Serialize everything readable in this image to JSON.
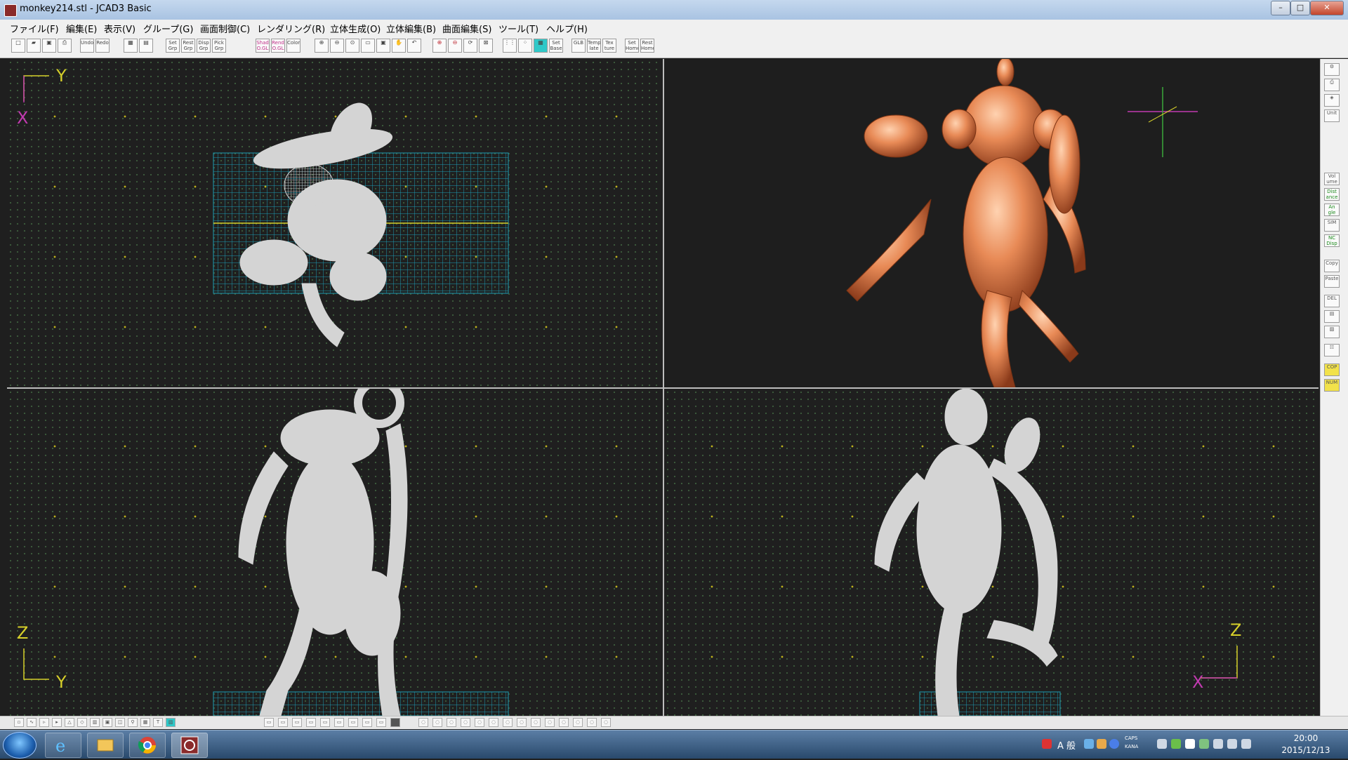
{
  "window": {
    "title": "monkey214.stl - JCAD3 Basic",
    "controls": {
      "minimize": "–",
      "maximize": "□",
      "close": "✕"
    }
  },
  "menubar": [
    "ファイル(F)",
    "編集(E)",
    "表示(V)",
    "グループ(G)",
    "画面制御(C)",
    "レンダリング(R)",
    "立体生成(O)",
    "立体編集(B)",
    "曲面編集(S)",
    "ツール(T)",
    "ヘルプ(H)"
  ],
  "toolbar": {
    "labels": [
      "Undo",
      "Redo",
      "Set Grp",
      "Rest Grp",
      "Disp Grp",
      "Pick Grp",
      "Shad O.GL",
      "Rend O.GL",
      "Color",
      "Set Base",
      "GLB",
      "Temp late",
      "Tex ture",
      "Set Home",
      "Rest Home"
    ]
  },
  "viewports": {
    "top_left": {
      "axis_labels": [
        "Y",
        "X"
      ]
    },
    "bottom_left": {
      "axis_labels": [
        "Z",
        "Y"
      ]
    },
    "bottom_right": {
      "axis_labels": [
        "Z",
        "X"
      ]
    }
  },
  "right_panel": {
    "buttons": [
      "Unit",
      "Vol ume",
      "Dist ance",
      "An gle",
      "SIM",
      "NC Disp",
      "Copy",
      "Paste",
      "DEL",
      "COP",
      "NUM"
    ]
  },
  "taskbar": {
    "time": "20:00",
    "date": "2015/12/13",
    "ime": "A 般",
    "caps": "CAPS",
    "kana": "KANA"
  },
  "colors": {
    "viewport_bg": "#1f1f1f",
    "grid_cyan": "#1e9bb0",
    "wireframe": "#d4d4d4",
    "rendered_model": "#e88a56",
    "axis_yellow": "#d6cf2a",
    "axis_magenta": "#c13ab0"
  }
}
